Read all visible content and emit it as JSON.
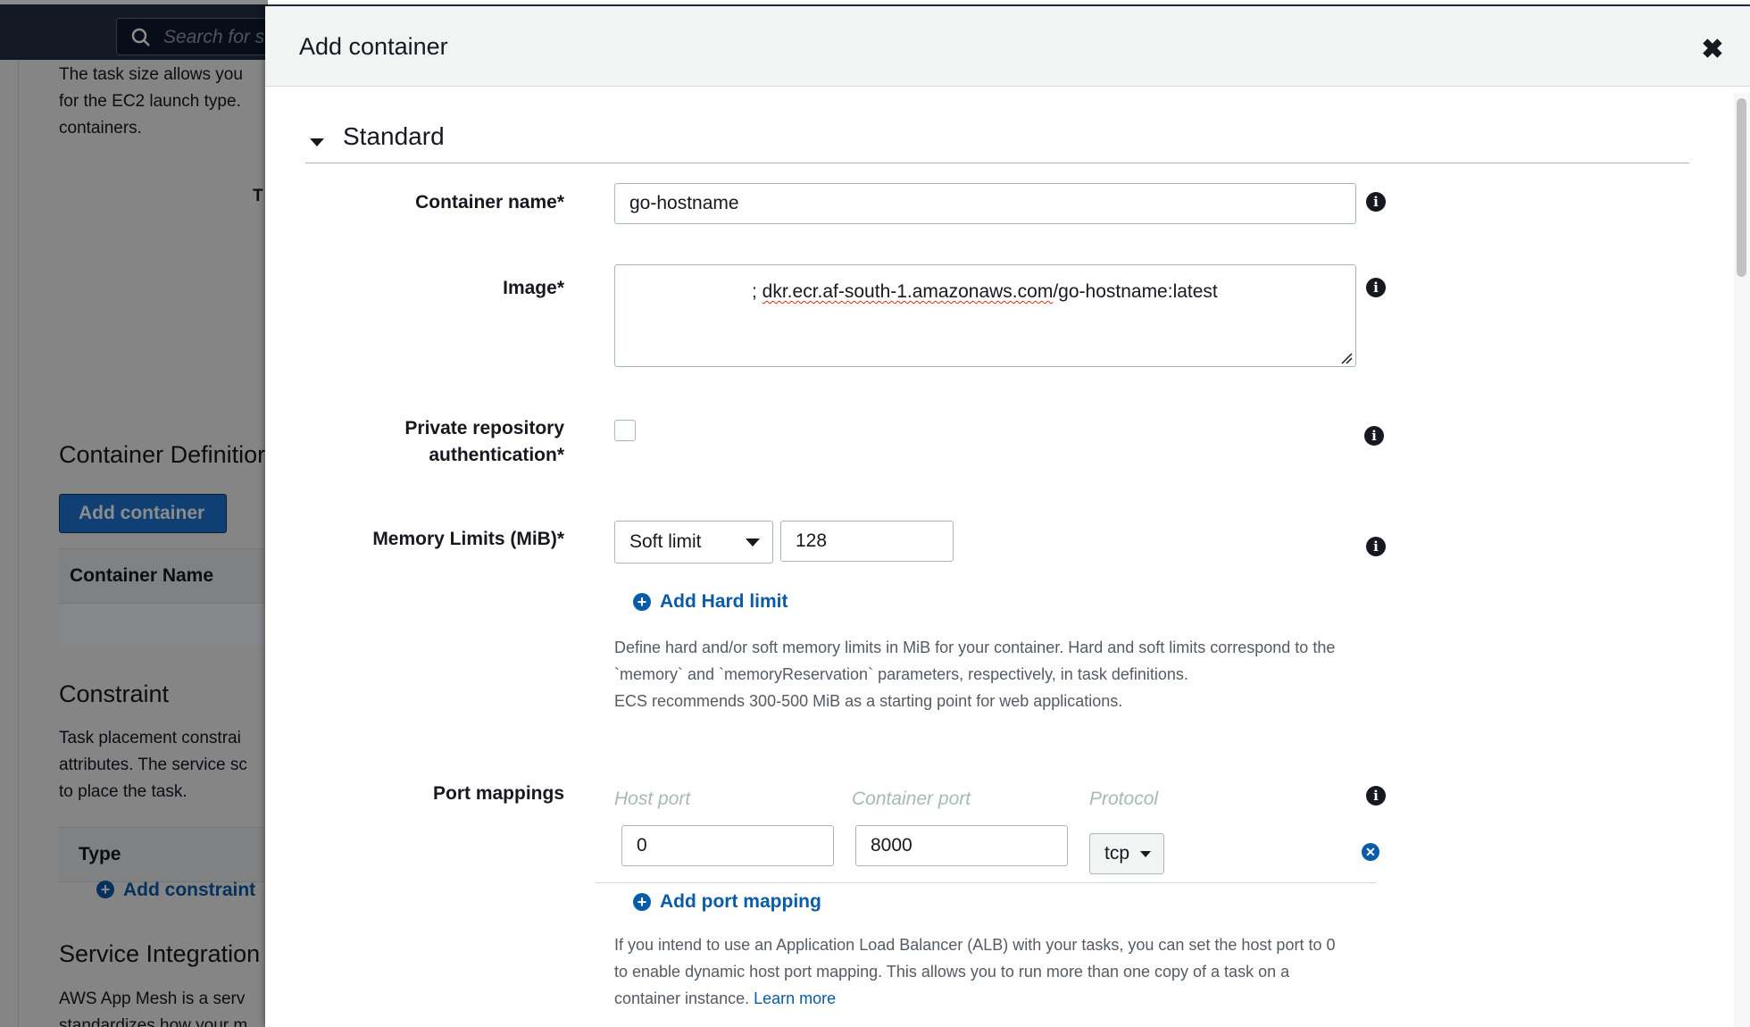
{
  "topbar": {
    "search_placeholder": "Search for s"
  },
  "background": {
    "intro_lines": [
      "The task size allows you",
      "for the EC2 launch type.",
      "containers."
    ],
    "truncated_label": "T",
    "container_definitions_heading": "Container Definitior",
    "add_container_button": "Add container",
    "table_header": "Container Name",
    "constraint_heading": "Constraint",
    "constraint_lines": [
      "Task placement constrai",
      "attributes. The service sc",
      "to place the task."
    ],
    "constraint_table_header": "Type",
    "add_constraint_link": "Add constraint",
    "service_integration_heading": "Service Integration",
    "service_integration_lines": [
      "AWS App Mesh is a serv",
      "standardizes how your m"
    ]
  },
  "modal": {
    "title": "Add container",
    "close_glyph": "✖",
    "section_title": "Standard",
    "container_name": {
      "label": "Container name*",
      "value": "go-hostname"
    },
    "image": {
      "label": "Image*",
      "value_prefix": "",
      "value_squiggled": "dkr.ecr.af-south-1.amazonaws.com",
      "value_suffix": "/go-hostname:latest",
      "value_lead": "; "
    },
    "private_repo": {
      "label_line1": "Private repository",
      "label_line2": "authentication*"
    },
    "memory": {
      "label": "Memory Limits (MiB)*",
      "select_value": "Soft limit",
      "value": "128",
      "add_hard_limit": "Add Hard limit",
      "help_lines": [
        "Define hard and/or soft memory limits in MiB for your container. Hard and soft limits correspond to the",
        "`memory` and `memoryReservation` parameters, respectively, in task definitions.",
        "ECS recommends 300-500 MiB as a starting point for web applications."
      ]
    },
    "ports": {
      "label": "Port mappings",
      "host_port_header": "Host port",
      "container_port_header": "Container port",
      "protocol_header": "Protocol",
      "host_port_value": "0",
      "container_port_value": "8000",
      "protocol_value": "tcp",
      "add_port_mapping": "Add port mapping",
      "help_lines": [
        "If you intend to use an Application Load Balancer (ALB) with your tasks, you can set the host port to 0",
        "to enable dynamic host port mapping. This allows you to run more than one copy of a task on a",
        "container instance."
      ],
      "learn_more": "Learn more"
    },
    "info_glyph": "i",
    "plus_glyph": "+",
    "remove_glyph": "✕"
  }
}
